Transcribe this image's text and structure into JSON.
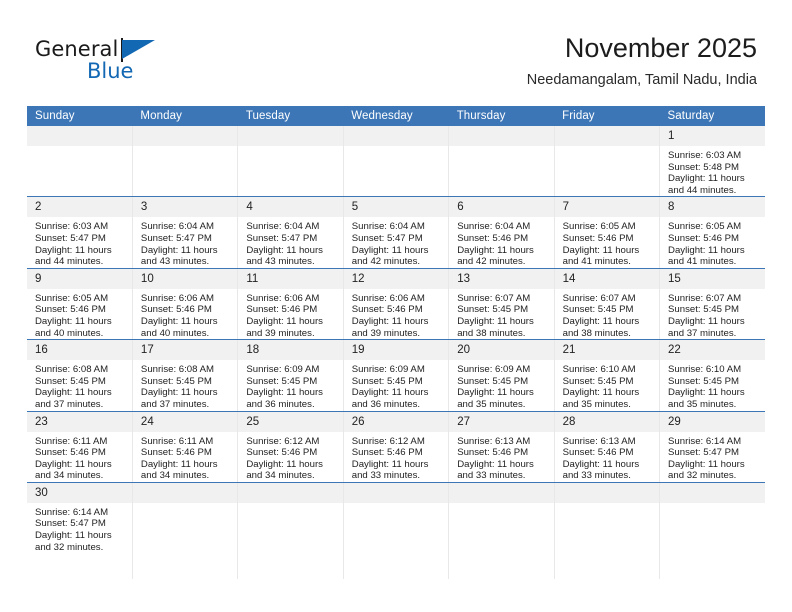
{
  "brand": {
    "word_one": "General",
    "word_two": "Blue",
    "accent_color": "#1268b3",
    "triangle_icon": "brand-triangle-icon"
  },
  "header": {
    "title": "November 2025",
    "subtitle": "Needamangalam, Tamil Nadu, India"
  },
  "theme": {
    "header_blue": "#3d76b6",
    "daynum_gray": "#f1f1f1",
    "row_rule": "#3d76b6"
  },
  "weekday_headers": [
    "Sunday",
    "Monday",
    "Tuesday",
    "Wednesday",
    "Thursday",
    "Friday",
    "Saturday"
  ],
  "labels": {
    "sunrise_prefix": "Sunrise:",
    "sunset_prefix": "Sunset:",
    "daylight_prefix": "Daylight:"
  },
  "weeks": [
    [
      {
        "day": "",
        "blank": true
      },
      {
        "day": "",
        "blank": true
      },
      {
        "day": "",
        "blank": true
      },
      {
        "day": "",
        "blank": true
      },
      {
        "day": "",
        "blank": true
      },
      {
        "day": "",
        "blank": true
      },
      {
        "day": "1",
        "sunrise": "Sunrise: 6:03 AM",
        "sunset": "Sunset: 5:48 PM",
        "daylight_1": "Daylight: 11 hours",
        "daylight_2": "and 44 minutes."
      }
    ],
    [
      {
        "day": "2",
        "sunrise": "Sunrise: 6:03 AM",
        "sunset": "Sunset: 5:47 PM",
        "daylight_1": "Daylight: 11 hours",
        "daylight_2": "and 44 minutes."
      },
      {
        "day": "3",
        "sunrise": "Sunrise: 6:04 AM",
        "sunset": "Sunset: 5:47 PM",
        "daylight_1": "Daylight: 11 hours",
        "daylight_2": "and 43 minutes."
      },
      {
        "day": "4",
        "sunrise": "Sunrise: 6:04 AM",
        "sunset": "Sunset: 5:47 PM",
        "daylight_1": "Daylight: 11 hours",
        "daylight_2": "and 43 minutes."
      },
      {
        "day": "5",
        "sunrise": "Sunrise: 6:04 AM",
        "sunset": "Sunset: 5:47 PM",
        "daylight_1": "Daylight: 11 hours",
        "daylight_2": "and 42 minutes."
      },
      {
        "day": "6",
        "sunrise": "Sunrise: 6:04 AM",
        "sunset": "Sunset: 5:46 PM",
        "daylight_1": "Daylight: 11 hours",
        "daylight_2": "and 42 minutes."
      },
      {
        "day": "7",
        "sunrise": "Sunrise: 6:05 AM",
        "sunset": "Sunset: 5:46 PM",
        "daylight_1": "Daylight: 11 hours",
        "daylight_2": "and 41 minutes."
      },
      {
        "day": "8",
        "sunrise": "Sunrise: 6:05 AM",
        "sunset": "Sunset: 5:46 PM",
        "daylight_1": "Daylight: 11 hours",
        "daylight_2": "and 41 minutes."
      }
    ],
    [
      {
        "day": "9",
        "sunrise": "Sunrise: 6:05 AM",
        "sunset": "Sunset: 5:46 PM",
        "daylight_1": "Daylight: 11 hours",
        "daylight_2": "and 40 minutes."
      },
      {
        "day": "10",
        "sunrise": "Sunrise: 6:06 AM",
        "sunset": "Sunset: 5:46 PM",
        "daylight_1": "Daylight: 11 hours",
        "daylight_2": "and 40 minutes."
      },
      {
        "day": "11",
        "sunrise": "Sunrise: 6:06 AM",
        "sunset": "Sunset: 5:46 PM",
        "daylight_1": "Daylight: 11 hours",
        "daylight_2": "and 39 minutes."
      },
      {
        "day": "12",
        "sunrise": "Sunrise: 6:06 AM",
        "sunset": "Sunset: 5:46 PM",
        "daylight_1": "Daylight: 11 hours",
        "daylight_2": "and 39 minutes."
      },
      {
        "day": "13",
        "sunrise": "Sunrise: 6:07 AM",
        "sunset": "Sunset: 5:45 PM",
        "daylight_1": "Daylight: 11 hours",
        "daylight_2": "and 38 minutes."
      },
      {
        "day": "14",
        "sunrise": "Sunrise: 6:07 AM",
        "sunset": "Sunset: 5:45 PM",
        "daylight_1": "Daylight: 11 hours",
        "daylight_2": "and 38 minutes."
      },
      {
        "day": "15",
        "sunrise": "Sunrise: 6:07 AM",
        "sunset": "Sunset: 5:45 PM",
        "daylight_1": "Daylight: 11 hours",
        "daylight_2": "and 37 minutes."
      }
    ],
    [
      {
        "day": "16",
        "sunrise": "Sunrise: 6:08 AM",
        "sunset": "Sunset: 5:45 PM",
        "daylight_1": "Daylight: 11 hours",
        "daylight_2": "and 37 minutes."
      },
      {
        "day": "17",
        "sunrise": "Sunrise: 6:08 AM",
        "sunset": "Sunset: 5:45 PM",
        "daylight_1": "Daylight: 11 hours",
        "daylight_2": "and 37 minutes."
      },
      {
        "day": "18",
        "sunrise": "Sunrise: 6:09 AM",
        "sunset": "Sunset: 5:45 PM",
        "daylight_1": "Daylight: 11 hours",
        "daylight_2": "and 36 minutes."
      },
      {
        "day": "19",
        "sunrise": "Sunrise: 6:09 AM",
        "sunset": "Sunset: 5:45 PM",
        "daylight_1": "Daylight: 11 hours",
        "daylight_2": "and 36 minutes."
      },
      {
        "day": "20",
        "sunrise": "Sunrise: 6:09 AM",
        "sunset": "Sunset: 5:45 PM",
        "daylight_1": "Daylight: 11 hours",
        "daylight_2": "and 35 minutes."
      },
      {
        "day": "21",
        "sunrise": "Sunrise: 6:10 AM",
        "sunset": "Sunset: 5:45 PM",
        "daylight_1": "Daylight: 11 hours",
        "daylight_2": "and 35 minutes."
      },
      {
        "day": "22",
        "sunrise": "Sunrise: 6:10 AM",
        "sunset": "Sunset: 5:45 PM",
        "daylight_1": "Daylight: 11 hours",
        "daylight_2": "and 35 minutes."
      }
    ],
    [
      {
        "day": "23",
        "sunrise": "Sunrise: 6:11 AM",
        "sunset": "Sunset: 5:46 PM",
        "daylight_1": "Daylight: 11 hours",
        "daylight_2": "and 34 minutes."
      },
      {
        "day": "24",
        "sunrise": "Sunrise: 6:11 AM",
        "sunset": "Sunset: 5:46 PM",
        "daylight_1": "Daylight: 11 hours",
        "daylight_2": "and 34 minutes."
      },
      {
        "day": "25",
        "sunrise": "Sunrise: 6:12 AM",
        "sunset": "Sunset: 5:46 PM",
        "daylight_1": "Daylight: 11 hours",
        "daylight_2": "and 34 minutes."
      },
      {
        "day": "26",
        "sunrise": "Sunrise: 6:12 AM",
        "sunset": "Sunset: 5:46 PM",
        "daylight_1": "Daylight: 11 hours",
        "daylight_2": "and 33 minutes."
      },
      {
        "day": "27",
        "sunrise": "Sunrise: 6:13 AM",
        "sunset": "Sunset: 5:46 PM",
        "daylight_1": "Daylight: 11 hours",
        "daylight_2": "and 33 minutes."
      },
      {
        "day": "28",
        "sunrise": "Sunrise: 6:13 AM",
        "sunset": "Sunset: 5:46 PM",
        "daylight_1": "Daylight: 11 hours",
        "daylight_2": "and 33 minutes."
      },
      {
        "day": "29",
        "sunrise": "Sunrise: 6:14 AM",
        "sunset": "Sunset: 5:47 PM",
        "daylight_1": "Daylight: 11 hours",
        "daylight_2": "and 32 minutes."
      }
    ],
    [
      {
        "day": "30",
        "sunrise": "Sunrise: 6:14 AM",
        "sunset": "Sunset: 5:47 PM",
        "daylight_1": "Daylight: 11 hours",
        "daylight_2": "and 32 minutes."
      },
      {
        "day": "",
        "blank": true
      },
      {
        "day": "",
        "blank": true
      },
      {
        "day": "",
        "blank": true
      },
      {
        "day": "",
        "blank": true
      },
      {
        "day": "",
        "blank": true
      },
      {
        "day": "",
        "blank": true
      }
    ]
  ]
}
